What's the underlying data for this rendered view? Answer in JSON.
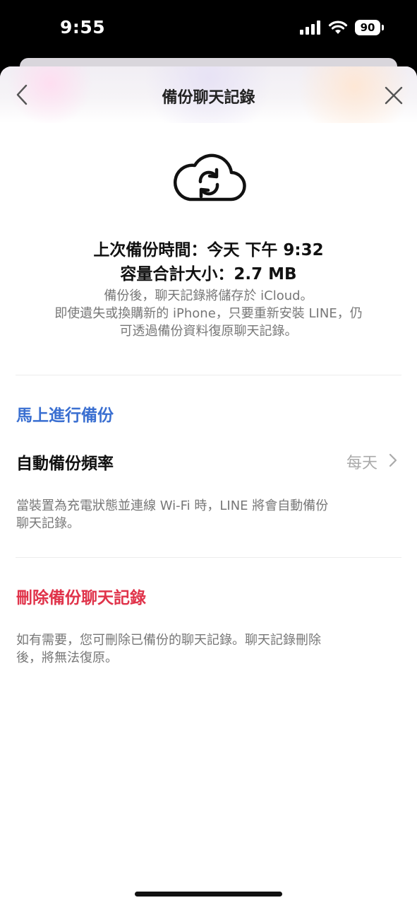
{
  "status_bar": {
    "time": "9:55",
    "battery": "90"
  },
  "header": {
    "title": "備份聊天記錄",
    "back_icon": "chevron-left-icon",
    "close_icon": "close-icon"
  },
  "summary": {
    "icon": "cloud-sync-icon",
    "last_backup": "上次備份時間：今天 下午 9:32",
    "total_size": "容量合計大小：2.7 MB",
    "description_lines": [
      "備份後，聊天記錄將儲存於 iCloud。",
      "即使遺失或換購新的 iPhone，只要重新安裝 LINE，仍",
      "可透過備份資料復原聊天記錄。"
    ]
  },
  "backup_now": {
    "label": "馬上進行備份",
    "color": "#3a6fd1"
  },
  "auto_frequency": {
    "label": "自動備份頻率",
    "value": "每天",
    "description_lines": [
      "當裝置為充電狀態並連線 Wi-Fi 時，LINE 將會自動備份",
      "聊天記錄。"
    ]
  },
  "delete_backup": {
    "label": "刪除備份聊天記錄",
    "color": "#e0334a",
    "description_lines": [
      "如有需要，您可刪除已備份的聊天記錄。聊天記錄刪除",
      "後，將無法復原。"
    ]
  }
}
